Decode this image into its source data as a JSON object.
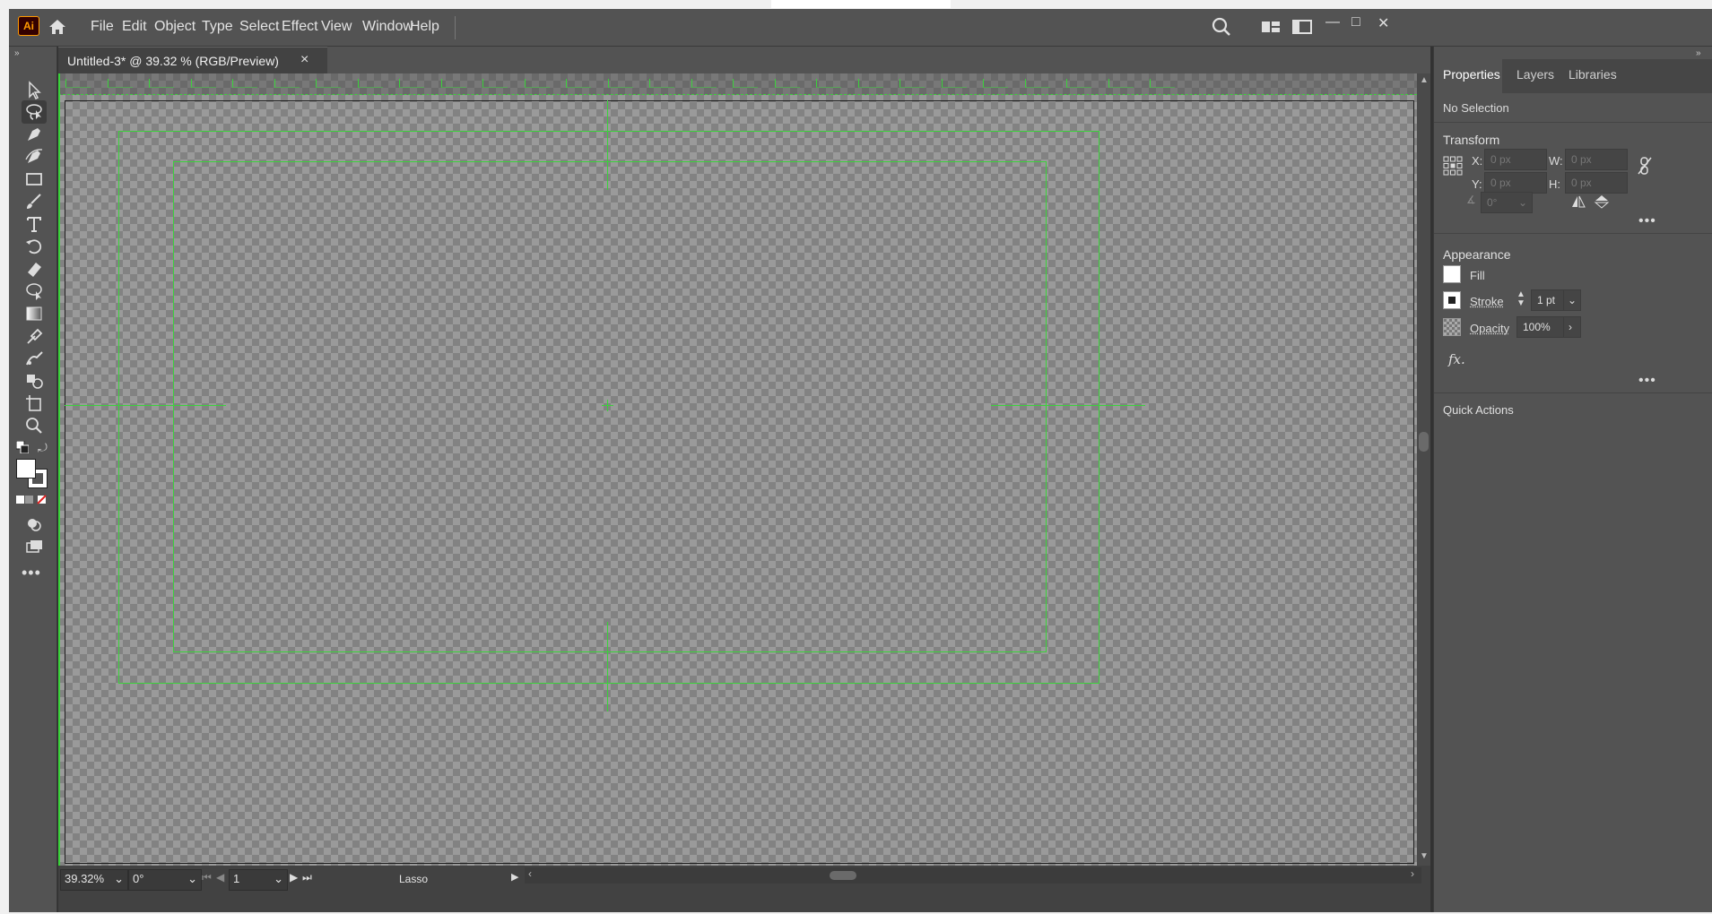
{
  "app": {
    "logo": "Ai"
  },
  "menu": [
    "File",
    "Edit",
    "Object",
    "Type",
    "Select",
    "Effect",
    "View",
    "Window",
    "Help"
  ],
  "window_controls": {
    "minimize": "—",
    "maximize": "□",
    "close": "✕"
  },
  "document": {
    "tab_title": "Untitled-3* @ 39.32 % (RGB/Preview)",
    "close": "×"
  },
  "status": {
    "zoom": "39.32%",
    "rotation": "0°",
    "artboard": "1",
    "tool": "Lasso"
  },
  "panel": {
    "tabs": [
      "Properties",
      "Layers",
      "Libraries"
    ],
    "selection": "No Selection",
    "transform": {
      "title": "Transform",
      "x_label": "X:",
      "x": "0 px",
      "y_label": "Y:",
      "y": "0 px",
      "w_label": "W:",
      "w": "0 px",
      "h_label": "H:",
      "h": "0 px",
      "angle": "0°"
    },
    "appearance": {
      "title": "Appearance",
      "fill_label": "Fill",
      "stroke_label": "Stroke",
      "stroke_value": "1 pt",
      "opacity_label": "Opacity",
      "opacity_value": "100%",
      "fx": "fx."
    },
    "quick_actions": "Quick Actions"
  },
  "colors": {
    "accent_guides": "#3bd23b",
    "panel_bg": "#535353",
    "ai_logo_bg": "#330000",
    "ai_logo_fg": "#ff9a00"
  },
  "icons": [
    "ai-logo-icon",
    "home-icon",
    "search-icon",
    "workspace-icon",
    "arrange-icon",
    "selection-tool-icon",
    "lasso-tool-icon",
    "pen-tool-icon",
    "curvature-tool-icon",
    "rectangle-tool-icon",
    "paintbrush-tool-icon",
    "type-tool-icon",
    "rotate-tool-icon",
    "eraser-tool-icon",
    "warp-tool-icon",
    "gradient-tool-icon",
    "eyedropper-tool-icon",
    "blend-tool-icon",
    "shape-builder-tool-icon",
    "artboard-tool-icon",
    "zoom-tool-icon",
    "fill-stroke-icon",
    "more-tools-icon"
  ]
}
